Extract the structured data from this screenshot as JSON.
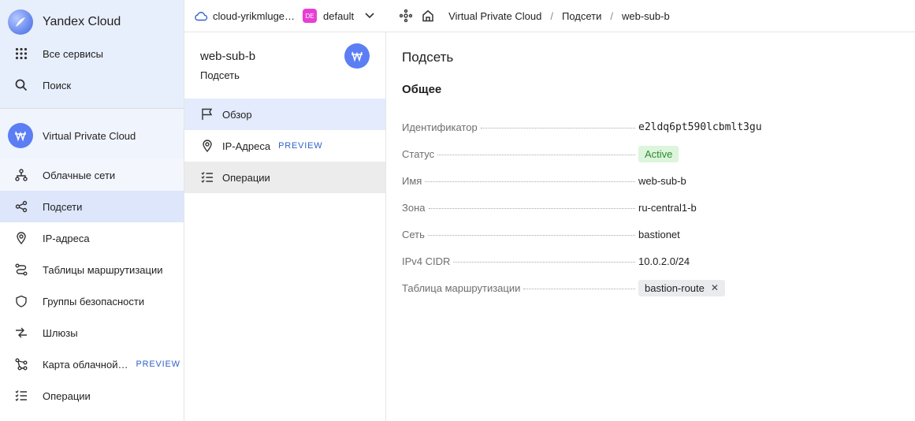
{
  "sidebar": {
    "brand": "Yandex Cloud",
    "all_services": "Все сервисы",
    "search": "Поиск",
    "service": "Virtual Private Cloud",
    "items": [
      {
        "label": "Облачные сети",
        "icon": "network-icon"
      },
      {
        "label": "Подсети",
        "icon": "subnet-icon"
      },
      {
        "label": "IP-адреса",
        "icon": "location-pin-icon"
      },
      {
        "label": "Таблицы маршрутизации",
        "icon": "route-icon"
      },
      {
        "label": "Группы безопасности",
        "icon": "shield-icon"
      },
      {
        "label": "Шлюзы",
        "icon": "gateway-icon"
      },
      {
        "label": "Карта облачной…",
        "icon": "map-icon",
        "tag": "PREVIEW"
      },
      {
        "label": "Операции",
        "icon": "list-icon"
      }
    ]
  },
  "topbar": {
    "cloud": "cloud-yrikmluge…",
    "folder_badge": "DE",
    "folder": "default",
    "breadcrumbs": [
      "Virtual Private Cloud",
      "Подсети",
      "web-sub-b"
    ]
  },
  "midpanel": {
    "title": "web-sub-b",
    "subtitle": "Подсеть",
    "items": [
      {
        "label": "Обзор"
      },
      {
        "label": "IP-Адреса",
        "tag": "PREVIEW"
      },
      {
        "label": "Операции"
      }
    ]
  },
  "content": {
    "title": "Подсеть",
    "section": "Общее",
    "props": {
      "id_key": "Идентификатор",
      "id_val": "e2ldq6pt590lcbmlt3gu",
      "status_key": "Статус",
      "status_val": "Active",
      "name_key": "Имя",
      "name_val": "web-sub-b",
      "zone_key": "Зона",
      "zone_val": "ru-central1-b",
      "net_key": "Сеть",
      "net_val": "bastionet",
      "cidr_key": "IPv4 CIDR",
      "cidr_val": "10.0.2.0/24",
      "rt_key": "Таблица маршрутизации",
      "rt_val": "bastion-route"
    }
  },
  "colors": {
    "accent": "#5b7ef4",
    "active_bg": "#dde6fb",
    "status_bg": "#dcf5dc",
    "status_fg": "#2e8b2e",
    "link": "#2f63c9"
  }
}
